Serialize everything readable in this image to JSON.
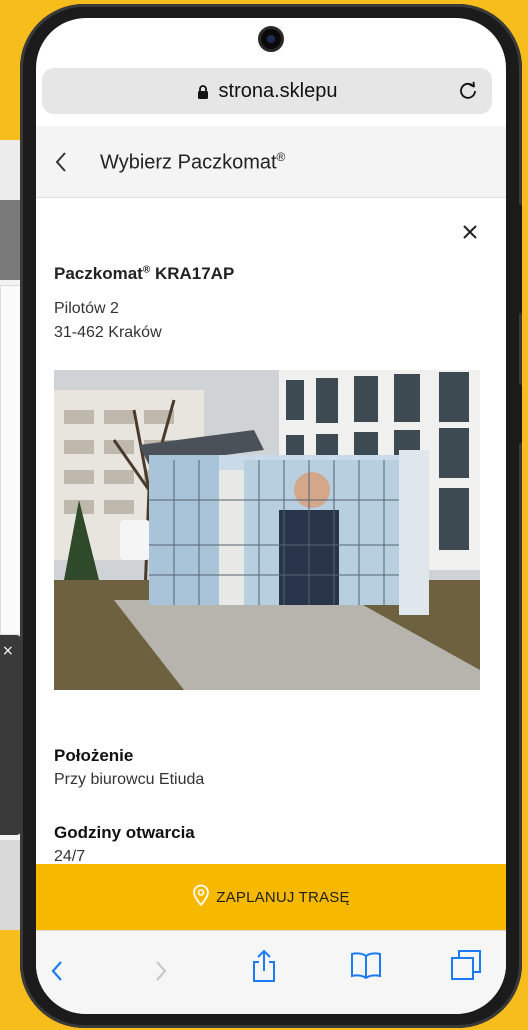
{
  "browser": {
    "url": "strona.sklepu"
  },
  "header": {
    "title": "Wybierz Paczkomat",
    "title_mark": "®"
  },
  "locker": {
    "name": "Paczkomat",
    "name_mark": "®",
    "code": "KRA17AP",
    "address_line1": "Pilotów 2",
    "address_line2": "31-462 Kraków"
  },
  "details": {
    "location_label": "Położenie",
    "location_value": "Przy biurowcu Etiuda",
    "hours_label": "Godziny otwarcia",
    "hours_value": "24/7"
  },
  "cta": {
    "label": "ZAPLANUJ TRASĘ"
  },
  "colors": {
    "brand_yellow": "#f7b900",
    "background": "#f7bd1c"
  },
  "icons": {
    "lock": "lock-icon",
    "reload": "reload-icon",
    "back": "chevron-left-icon",
    "close": "close-icon",
    "pin": "location-pin-icon",
    "share": "share-icon",
    "bookmarks": "book-icon",
    "tabs": "tabs-icon"
  }
}
